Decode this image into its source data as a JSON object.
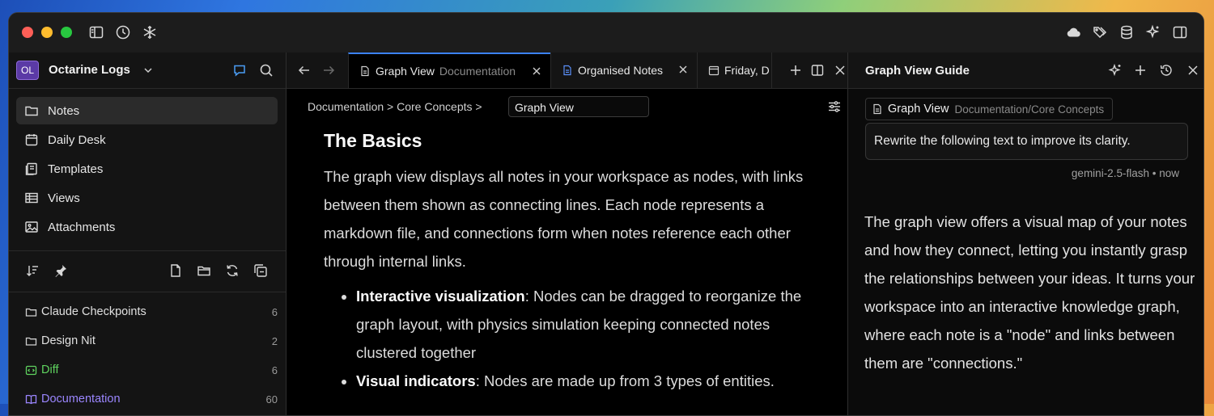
{
  "window": {
    "titlebar_icons_left": [
      "sidebar-toggle-icon",
      "history-icon",
      "snowflake-icon"
    ],
    "titlebar_icons_right": [
      "cloud-icon",
      "tags-icon",
      "database-icon",
      "ai-sparkle-icon",
      "right-panel-icon"
    ]
  },
  "workspace": {
    "avatar": "OL",
    "name": "Octarine Logs"
  },
  "sidebar": {
    "nav": [
      {
        "label": "Notes",
        "icon": "folder-icon",
        "active": true
      },
      {
        "label": "Daily Desk",
        "icon": "calendar-icon"
      },
      {
        "label": "Templates",
        "icon": "templates-icon"
      },
      {
        "label": "Views",
        "icon": "table-icon"
      },
      {
        "label": "Attachments",
        "icon": "image-icon"
      }
    ],
    "folders": [
      {
        "label": "Claude Checkpoints",
        "count": "6"
      },
      {
        "label": "Design Nit",
        "count": "2"
      },
      {
        "label": "Diff",
        "count": "6"
      },
      {
        "label": "Documentation",
        "count": "60"
      }
    ]
  },
  "tabs": [
    {
      "title": "Graph View",
      "path": "Documentation",
      "active": true
    },
    {
      "title": "Organised Notes"
    },
    {
      "title": "Friday, D"
    }
  ],
  "breadcrumb": {
    "path": "Documentation > Core Concepts >",
    "current": "Graph View"
  },
  "doc": {
    "heading": "The Basics",
    "paragraph": "The graph view displays all notes in your workspace as nodes, with links between them shown as connecting lines. Each node represents a markdown file, and connections form when notes reference each other through internal links.",
    "bullets": [
      {
        "term": "Interactive visualization",
        "text": ": Nodes can be dragged to reorganize the graph layout, with physics simulation keeping connected notes clustered together"
      },
      {
        "term": "Visual indicators",
        "text": ": Nodes are made up from 3 types of entities."
      }
    ]
  },
  "assistant": {
    "title": "Graph View Guide",
    "context_chip": {
      "name": "Graph View",
      "path": "Documentation/Core Concepts"
    },
    "prompt": "Rewrite the following text to improve its clarity.",
    "model": "gemini-2.5-flash",
    "separator": "•",
    "time": "now",
    "response": "The graph view offers a visual map of your notes and how they connect, letting you instantly grasp the relationships between your ideas. It turns your workspace into an interactive knowledge graph, where each note is a \"node\" and links between them are \"connections.\""
  },
  "colors": {
    "accent": "#3b82f6",
    "avatar_bg": "#5b3aa6",
    "diff_green": "#5fd35f",
    "doc_purple": "#9b86ff"
  }
}
